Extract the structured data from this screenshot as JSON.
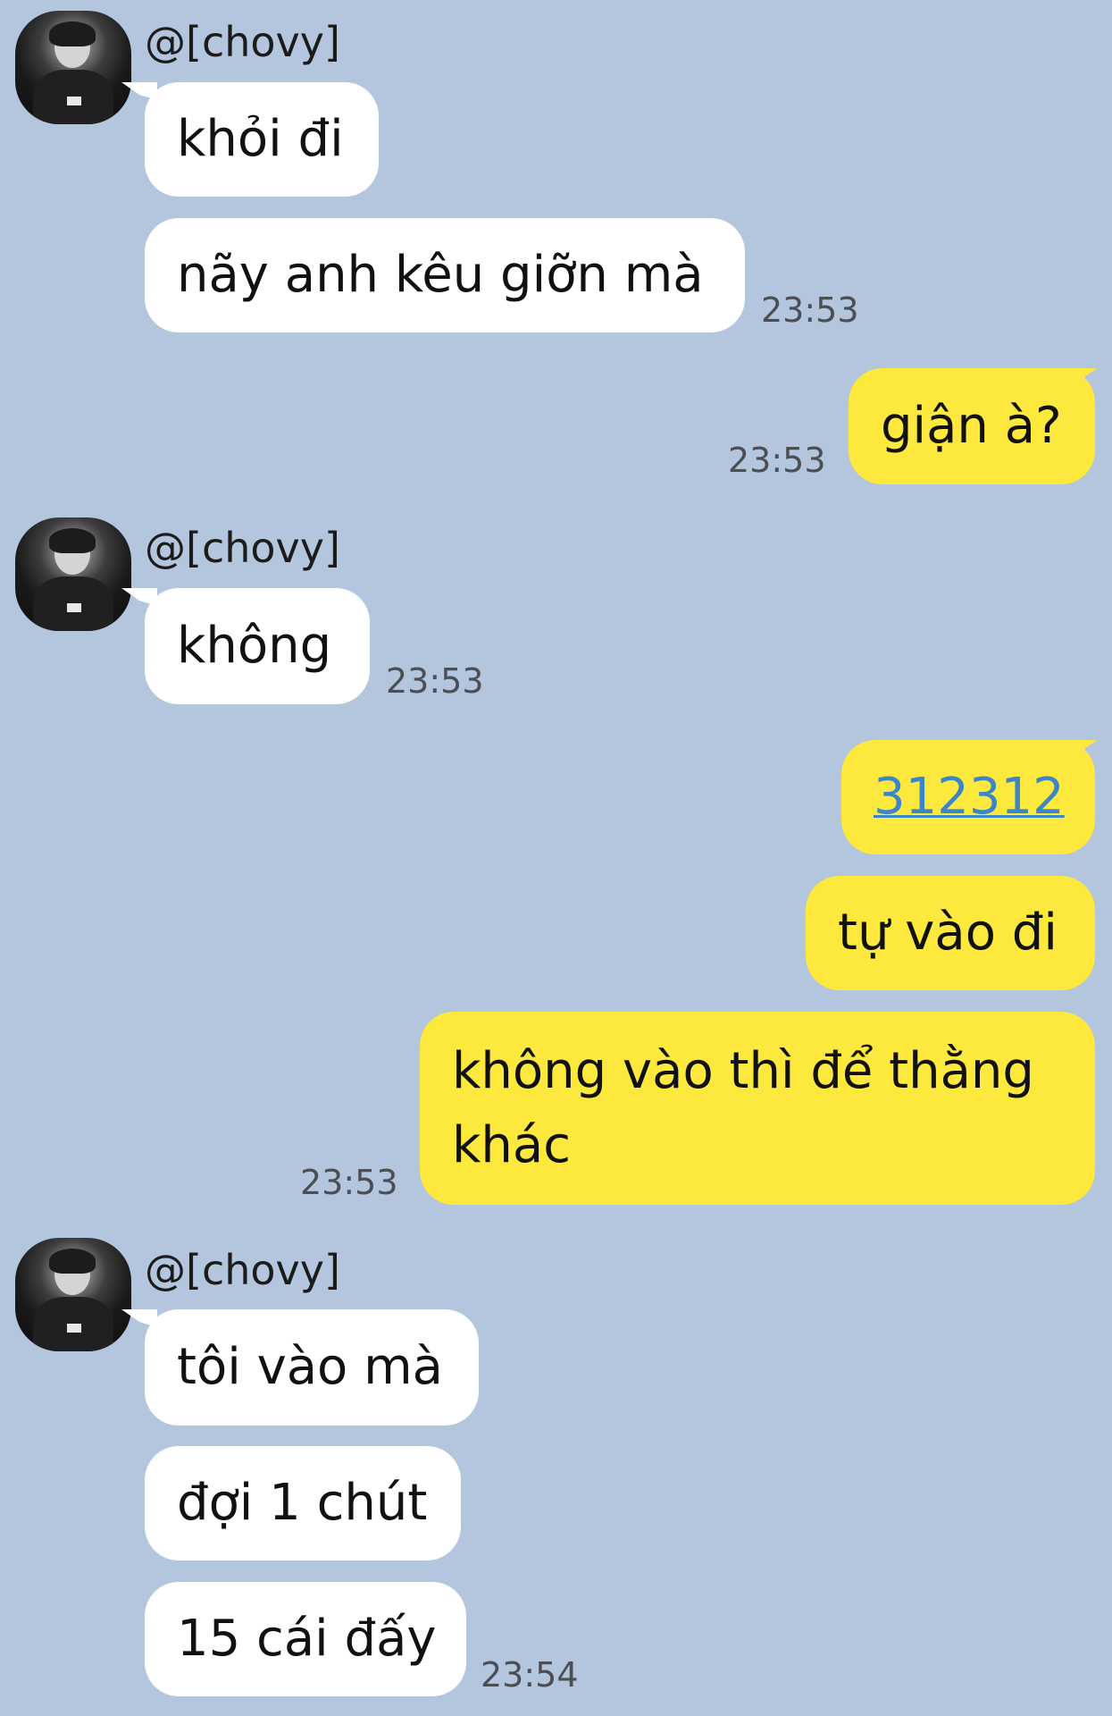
{
  "chat": {
    "groups": [
      {
        "sender": "@[chovy]",
        "messages": [
          "khỏi đi",
          "nãy anh kêu giỡn mà"
        ],
        "time": "23:53"
      },
      {
        "outgoing": true,
        "messages": [
          "giận à?"
        ],
        "time": "23:53"
      },
      {
        "sender": "@[chovy]",
        "messages": [
          "không"
        ],
        "time": "23:53"
      },
      {
        "outgoing": true,
        "messages": [
          "312312",
          "tự vào đi",
          "không vào thì để thằng khác"
        ],
        "time": "23:53"
      },
      {
        "sender": "@[chovy]",
        "messages": [
          "tôi vào mà",
          "đợi 1 chút",
          "15 cái đấy"
        ],
        "time": "23:54"
      }
    ]
  },
  "colors": {
    "background": "#b3c6dd",
    "incoming_bubble": "#ffffff",
    "outgoing_bubble": "#fde93d",
    "link": "#3a86c8"
  }
}
